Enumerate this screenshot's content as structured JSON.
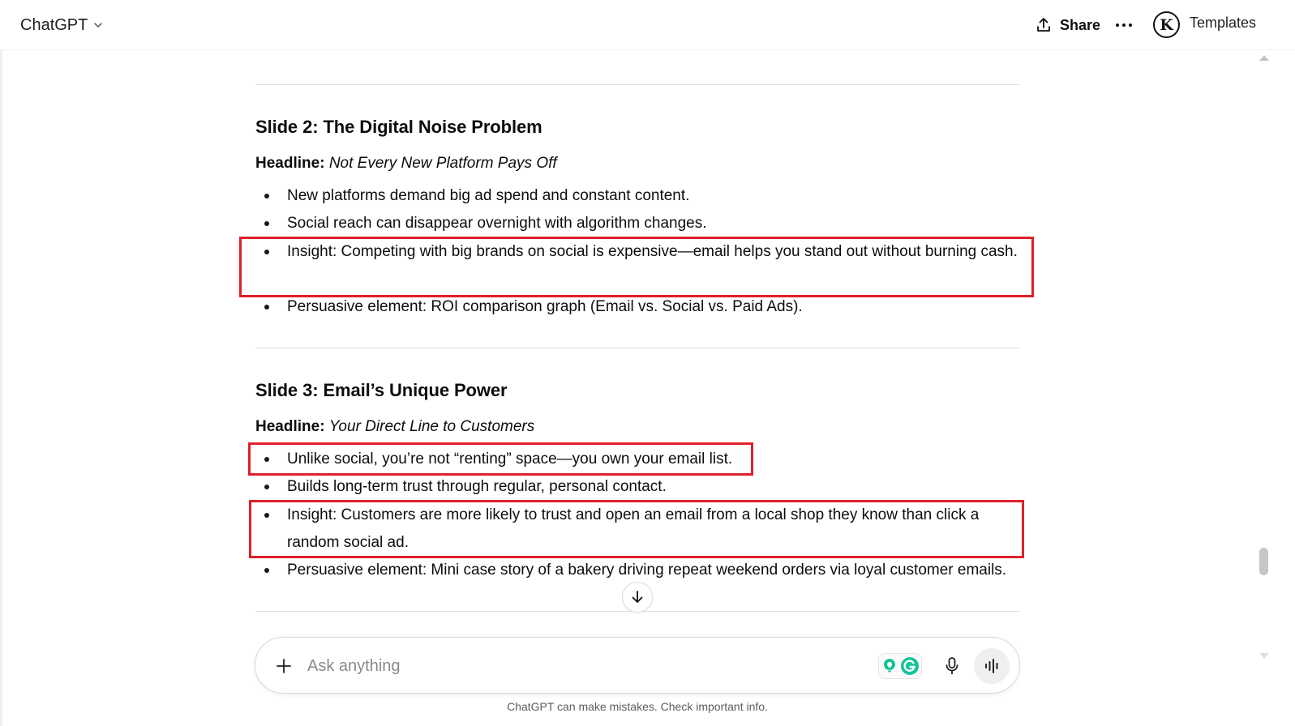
{
  "header": {
    "model_name": "ChatGPT",
    "share_label": "Share",
    "avatar_letter": "K",
    "templates_label": "Templates"
  },
  "slides": [
    {
      "title": "Slide 2: The Digital Noise Problem",
      "headline_label": "Headline:",
      "headline_text": "Not Every New Platform Pays Off",
      "bullets": [
        "New platforms demand big ad spend and constant content.",
        "Social reach can disappear overnight with algorithm changes.",
        "Insight: Competing with big brands on social is expensive—email helps you stand out without burning cash.",
        "Persuasive element: ROI comparison graph (Email vs. Social vs. Paid Ads)."
      ]
    },
    {
      "title": "Slide 3: Email’s Unique Power",
      "headline_label": "Headline:",
      "headline_text": "Your Direct Line to Customers",
      "bullets": [
        "Unlike social, you’re not “renting” space—you own your email list.",
        "Builds long-term trust through regular, personal contact.",
        "Insight: Customers are more likely to trust and open an email from a local shop they know than click a random social ad.",
        "Persuasive element: Mini case story of a bakery driving repeat weekend orders via loyal customer emails."
      ]
    }
  ],
  "composer": {
    "placeholder": "Ask anything"
  },
  "footer": {
    "disclaimer": "ChatGPT can make mistakes. Check important info."
  },
  "colors": {
    "highlight": "#e0202a",
    "text": "#0d0d0d",
    "grammarly": "#15c39a"
  }
}
